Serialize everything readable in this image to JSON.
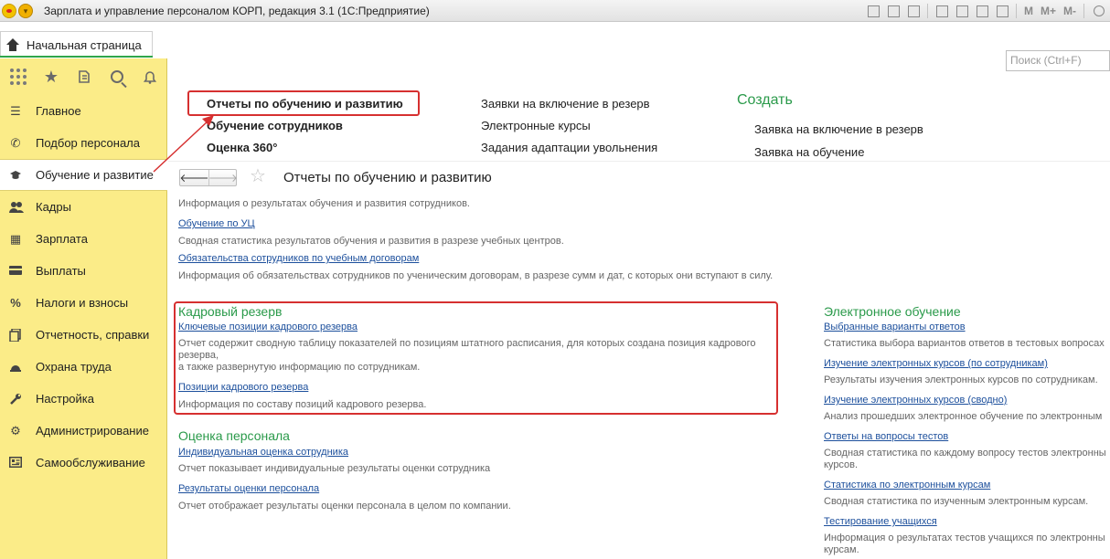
{
  "window": {
    "title": "Зарплата и управление персоналом КОРП, редакция 3.1  (1С:Предприятие)"
  },
  "toolbar": {
    "m": "M",
    "mplus": "M+",
    "mminus": "M-"
  },
  "home_tab": {
    "label": "Начальная страница"
  },
  "sidebar": {
    "items": [
      {
        "label": "Главное",
        "icon": "menu-lines-icon"
      },
      {
        "label": "Подбор персонала",
        "icon": "phone-icon"
      },
      {
        "label": "Обучение и развитие",
        "icon": "graduation-cap-icon"
      },
      {
        "label": "Кадры",
        "icon": "people-icon"
      },
      {
        "label": "Зарплата",
        "icon": "calculator-icon"
      },
      {
        "label": "Выплаты",
        "icon": "card-icon"
      },
      {
        "label": "Налоги и взносы",
        "icon": "percent-icon"
      },
      {
        "label": "Отчетность, справки",
        "icon": "documents-icon"
      },
      {
        "label": "Охрана труда",
        "icon": "helmet-icon"
      },
      {
        "label": "Настройка",
        "icon": "wrench-icon"
      },
      {
        "label": "Администрирование",
        "icon": "gears-icon"
      },
      {
        "label": "Самообслуживание",
        "icon": "id-card-icon"
      }
    ]
  },
  "search": {
    "placeholder": "Поиск (Ctrl+F)"
  },
  "section_menu": {
    "col1": [
      "Отчеты по обучению и развитию",
      "Обучение сотрудников",
      "Оценка 360°"
    ],
    "col2": [
      "Заявки на включение в резерв",
      "Электронные курсы",
      "Задания адаптации увольнения"
    ],
    "create_title": "Создать",
    "col3": [
      "Заявка на включение в резерв",
      "Заявка на обучение"
    ]
  },
  "report": {
    "title": "Отчеты по обучению и развитию",
    "intro": "Информация о результатах обучения и развития сотрудников.",
    "general": [
      {
        "link": "Обучение по УЦ",
        "desc": "Сводная статистика результатов обучения и развития в разрезе учебных центров."
      },
      {
        "link": "Обязательства сотрудников по учебным договорам",
        "desc": "Информация об обязательствах сотрудников по ученическим договорам, в разрезе сумм и дат, с которых они вступают в силу."
      }
    ],
    "reserve": {
      "title": "Кадровый резерв",
      "items": [
        {
          "link": "Ключевые позиции кадрового резерва",
          "desc1": "Отчет содержит сводную таблицу показателей по позициям штатного расписания, для которых создана позиция кадрового резерва,",
          "desc2": "а также развернутую информацию по сотрудникам."
        },
        {
          "link": "Позиции кадрового резерва",
          "desc": "Информация по составу позиций кадрового резерва."
        }
      ]
    },
    "evaluation": {
      "title": "Оценка персонала",
      "items": [
        {
          "link": "Индивидуальная оценка сотрудника",
          "desc": "Отчет показывает индивидуальные результаты оценки сотрудника"
        },
        {
          "link": "Результаты оценки персонала",
          "desc": "Отчет отображает результаты оценки персонала в целом по компании."
        }
      ]
    },
    "elearning": {
      "title": "Электронное обучение",
      "items": [
        {
          "link": "Выбранные варианты ответов",
          "desc": "Статистика выбора вариантов ответов в тестовых вопросах"
        },
        {
          "link": "Изучение электронных курсов (по сотрудникам)",
          "desc": "Результаты изучения электронных курсов по сотрудникам."
        },
        {
          "link": "Изучение электронных курсов (сводно)",
          "desc": "Анализ прошедших электронное обучение по электронным"
        },
        {
          "link": "Ответы на вопросы тестов",
          "desc1": "Сводная статистика по каждому вопросу тестов электронны",
          "desc2": "курсов."
        },
        {
          "link": "Статистика по электронным курсам",
          "desc": "Сводная статистика по изученным электронным курсам."
        },
        {
          "link": "Тестирование учащихся",
          "desc1": "Информация о результатах тестов учащихся по электронны",
          "desc2": "курсам."
        }
      ]
    }
  },
  "colors": {
    "sidebar_bg": "#fbec88",
    "section_green": "#2a9a4a",
    "link_blue": "#1c4f9c",
    "highlight_red": "#d63030"
  }
}
